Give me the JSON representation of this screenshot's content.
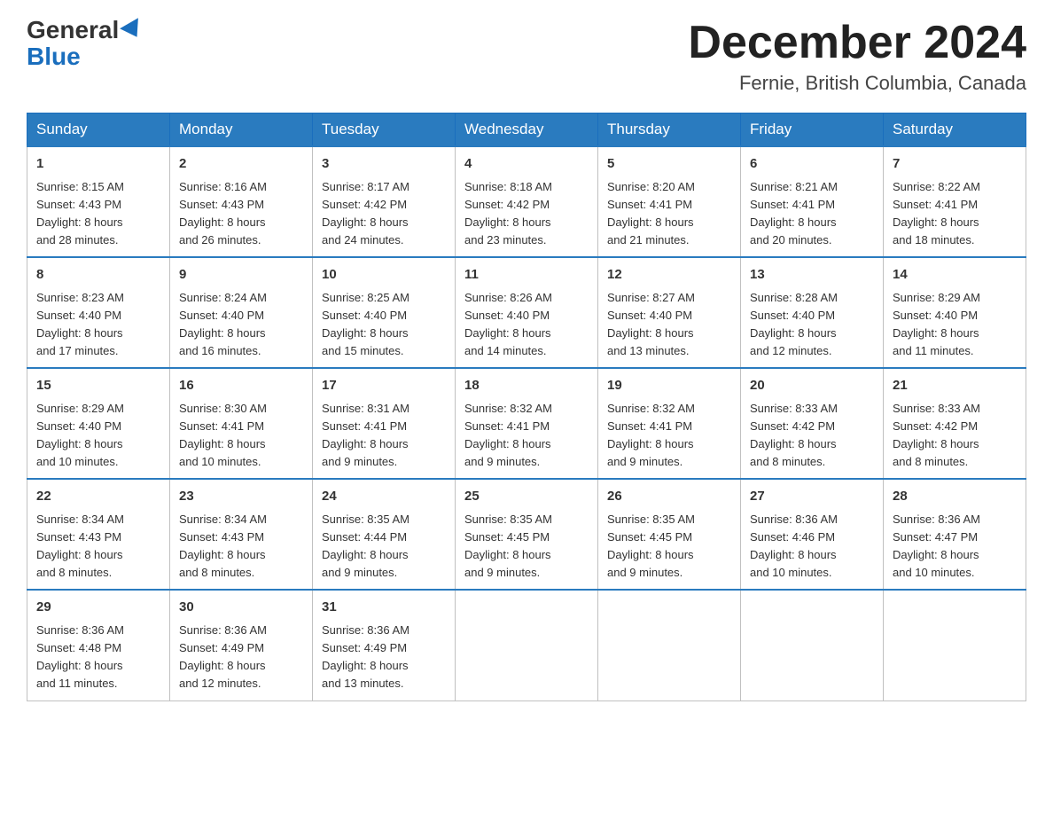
{
  "logo": {
    "general": "General",
    "blue": "Blue"
  },
  "header": {
    "month_year": "December 2024",
    "location": "Fernie, British Columbia, Canada"
  },
  "days_of_week": [
    "Sunday",
    "Monday",
    "Tuesday",
    "Wednesday",
    "Thursday",
    "Friday",
    "Saturday"
  ],
  "weeks": [
    [
      {
        "day": "1",
        "sunrise": "8:15 AM",
        "sunset": "4:43 PM",
        "daylight": "8 hours and 28 minutes."
      },
      {
        "day": "2",
        "sunrise": "8:16 AM",
        "sunset": "4:43 PM",
        "daylight": "8 hours and 26 minutes."
      },
      {
        "day": "3",
        "sunrise": "8:17 AM",
        "sunset": "4:42 PM",
        "daylight": "8 hours and 24 minutes."
      },
      {
        "day": "4",
        "sunrise": "8:18 AM",
        "sunset": "4:42 PM",
        "daylight": "8 hours and 23 minutes."
      },
      {
        "day": "5",
        "sunrise": "8:20 AM",
        "sunset": "4:41 PM",
        "daylight": "8 hours and 21 minutes."
      },
      {
        "day": "6",
        "sunrise": "8:21 AM",
        "sunset": "4:41 PM",
        "daylight": "8 hours and 20 minutes."
      },
      {
        "day": "7",
        "sunrise": "8:22 AM",
        "sunset": "4:41 PM",
        "daylight": "8 hours and 18 minutes."
      }
    ],
    [
      {
        "day": "8",
        "sunrise": "8:23 AM",
        "sunset": "4:40 PM",
        "daylight": "8 hours and 17 minutes."
      },
      {
        "day": "9",
        "sunrise": "8:24 AM",
        "sunset": "4:40 PM",
        "daylight": "8 hours and 16 minutes."
      },
      {
        "day": "10",
        "sunrise": "8:25 AM",
        "sunset": "4:40 PM",
        "daylight": "8 hours and 15 minutes."
      },
      {
        "day": "11",
        "sunrise": "8:26 AM",
        "sunset": "4:40 PM",
        "daylight": "8 hours and 14 minutes."
      },
      {
        "day": "12",
        "sunrise": "8:27 AM",
        "sunset": "4:40 PM",
        "daylight": "8 hours and 13 minutes."
      },
      {
        "day": "13",
        "sunrise": "8:28 AM",
        "sunset": "4:40 PM",
        "daylight": "8 hours and 12 minutes."
      },
      {
        "day": "14",
        "sunrise": "8:29 AM",
        "sunset": "4:40 PM",
        "daylight": "8 hours and 11 minutes."
      }
    ],
    [
      {
        "day": "15",
        "sunrise": "8:29 AM",
        "sunset": "4:40 PM",
        "daylight": "8 hours and 10 minutes."
      },
      {
        "day": "16",
        "sunrise": "8:30 AM",
        "sunset": "4:41 PM",
        "daylight": "8 hours and 10 minutes."
      },
      {
        "day": "17",
        "sunrise": "8:31 AM",
        "sunset": "4:41 PM",
        "daylight": "8 hours and 9 minutes."
      },
      {
        "day": "18",
        "sunrise": "8:32 AM",
        "sunset": "4:41 PM",
        "daylight": "8 hours and 9 minutes."
      },
      {
        "day": "19",
        "sunrise": "8:32 AM",
        "sunset": "4:41 PM",
        "daylight": "8 hours and 9 minutes."
      },
      {
        "day": "20",
        "sunrise": "8:33 AM",
        "sunset": "4:42 PM",
        "daylight": "8 hours and 8 minutes."
      },
      {
        "day": "21",
        "sunrise": "8:33 AM",
        "sunset": "4:42 PM",
        "daylight": "8 hours and 8 minutes."
      }
    ],
    [
      {
        "day": "22",
        "sunrise": "8:34 AM",
        "sunset": "4:43 PM",
        "daylight": "8 hours and 8 minutes."
      },
      {
        "day": "23",
        "sunrise": "8:34 AM",
        "sunset": "4:43 PM",
        "daylight": "8 hours and 8 minutes."
      },
      {
        "day": "24",
        "sunrise": "8:35 AM",
        "sunset": "4:44 PM",
        "daylight": "8 hours and 9 minutes."
      },
      {
        "day": "25",
        "sunrise": "8:35 AM",
        "sunset": "4:45 PM",
        "daylight": "8 hours and 9 minutes."
      },
      {
        "day": "26",
        "sunrise": "8:35 AM",
        "sunset": "4:45 PM",
        "daylight": "8 hours and 9 minutes."
      },
      {
        "day": "27",
        "sunrise": "8:36 AM",
        "sunset": "4:46 PM",
        "daylight": "8 hours and 10 minutes."
      },
      {
        "day": "28",
        "sunrise": "8:36 AM",
        "sunset": "4:47 PM",
        "daylight": "8 hours and 10 minutes."
      }
    ],
    [
      {
        "day": "29",
        "sunrise": "8:36 AM",
        "sunset": "4:48 PM",
        "daylight": "8 hours and 11 minutes."
      },
      {
        "day": "30",
        "sunrise": "8:36 AM",
        "sunset": "4:49 PM",
        "daylight": "8 hours and 12 minutes."
      },
      {
        "day": "31",
        "sunrise": "8:36 AM",
        "sunset": "4:49 PM",
        "daylight": "8 hours and 13 minutes."
      },
      null,
      null,
      null,
      null
    ]
  ],
  "labels": {
    "sunrise": "Sunrise:",
    "sunset": "Sunset:",
    "daylight": "Daylight:"
  }
}
